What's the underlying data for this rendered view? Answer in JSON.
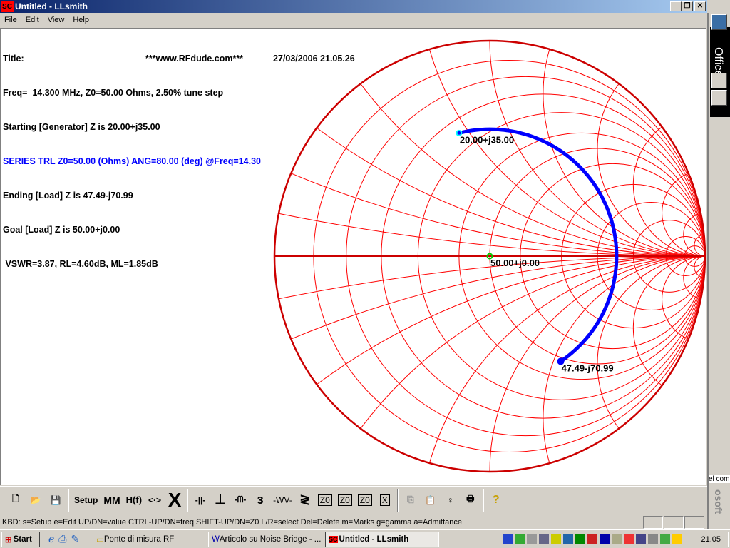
{
  "window": {
    "title": "Untitled - LLsmith",
    "app_icon": "SC",
    "minimize": "_",
    "restore": "❐",
    "close": "✕"
  },
  "menu": [
    "File",
    "Edit",
    "View",
    "Help"
  ],
  "info": {
    "title_label": "Title:",
    "site": "***www.RFdude.com***",
    "datetime": "27/03/2006 21.05.26",
    "freq_line": "Freq=  14.300 MHz, Z0=50.00 Ohms, 2.50% tune step",
    "start_line": "Starting [Generator] Z is 20.00+j35.00",
    "element_line": "SERIES TRL Z0=50.00 (Ohms) ANG=80.00 (deg) @Freq=14.30",
    "end_line": "Ending [Load] Z is 47.49-j70.99",
    "goal_line": "Goal [Load] Z is 50.00+j0.00",
    "vswr_line": " VSWR=3.87, RL=4.60dB, ML=1.85dB"
  },
  "chart_data": {
    "type": "smith",
    "z0": 50,
    "resistance_circles": [
      0.1,
      0.2,
      0.33,
      0.5,
      0.75,
      1,
      1.33,
      2,
      3,
      5,
      10,
      20
    ],
    "reactance_arcs": [
      0.1,
      0.2,
      0.33,
      0.5,
      0.75,
      1,
      1.33,
      2,
      3,
      5,
      10,
      20
    ],
    "grid_color": "#ff0000",
    "outline_color": "#cc0000",
    "trace_color": "#0000ff",
    "trace": {
      "start": {
        "r": 20.0,
        "x": 35.0
      },
      "line_z0": 50,
      "angle_deg": 80,
      "end": {
        "r": 47.49,
        "x": -70.99
      }
    },
    "markers": [
      {
        "label": "20.00+j35.00",
        "r": 20.0,
        "x": 35.0,
        "color": "#00ffff"
      },
      {
        "label": "50.00+j0.00",
        "r": 50.0,
        "x": 0.0,
        "color": "#00cc00"
      },
      {
        "label": "47.49-j70.99",
        "r": 47.49,
        "x": -70.99,
        "color": "#0000ff"
      }
    ]
  },
  "toolbar": {
    "new": "🗋",
    "open": "📂",
    "save": "💾",
    "setup": "Setup",
    "mm": "MM",
    "hf": "H(f)",
    "swap": "<·>",
    "delete": "X",
    "cap_series": "-||-",
    "cap_shunt": "⊥",
    "ind_series": "-ᗰ-",
    "ind_shunt": "ɜ",
    "res_series": "-WV-",
    "res_shunt": "≷",
    "tl_series": "Z0",
    "tl_short": "Z0",
    "tl_open": "Z0",
    "custom": "X",
    "copy": "⎘",
    "paste": "📋",
    "marker": "♀",
    "print": "🖶",
    "help": "?"
  },
  "status": {
    "kbd": "KBD:   s=Setup  e=Edit  UP/DN=value CTRL-UP/DN=freq  SHIFT-UP/DN=Z0 L/R=select  Del=Delete m=Marks g=gamma a=Admittance"
  },
  "taskbar": {
    "start": "Start",
    "tasks": [
      "Ponte di misura RF",
      "Articolo su Noise Bridge - ...",
      "Untitled - LLsmith"
    ],
    "clock": "21.05"
  },
  "officebar": {
    "label": "Office",
    "side_text_1": "el com",
    "side_text_2": "osoft"
  }
}
